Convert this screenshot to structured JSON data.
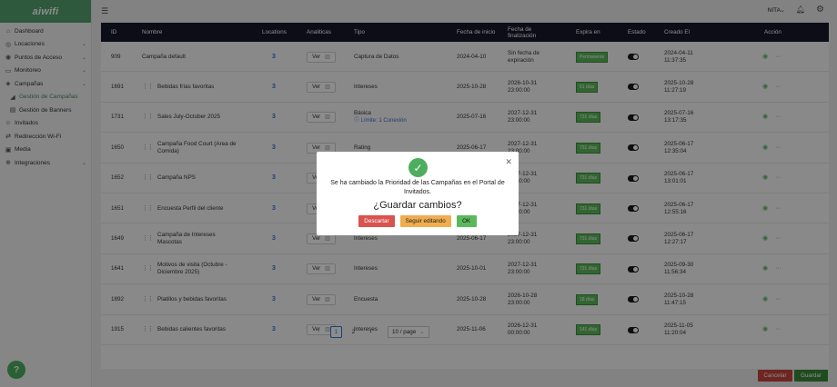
{
  "brand": {
    "logo_text": "aiwifi",
    "color": "#56a26f"
  },
  "sidebar": {
    "items": [
      {
        "label": "Dashboard",
        "icon": "home-icon",
        "chevron": false
      },
      {
        "label": "Locaciones",
        "icon": "location-icon",
        "chevron": true
      },
      {
        "label": "Puntos de Acceso",
        "icon": "wifi-icon",
        "chevron": true
      },
      {
        "label": "Monitoreo",
        "icon": "monitor-icon",
        "chevron": true
      },
      {
        "label": "Campañas",
        "icon": "campaign-icon",
        "chevron": true
      },
      {
        "label": "Gestión de Campañas",
        "icon": "chart-icon",
        "sub": true,
        "active": true
      },
      {
        "label": "Gestión de Banners",
        "icon": "banner-icon",
        "sub": true
      },
      {
        "label": "Invitados",
        "icon": "guests-icon",
        "chevron": false
      },
      {
        "label": "Redirección Wi-Fi",
        "icon": "redirect-icon",
        "chevron": false
      },
      {
        "label": "Media",
        "icon": "media-icon",
        "chevron": false
      },
      {
        "label": "Integraciones",
        "icon": "integrations-icon",
        "chevron": true
      }
    ]
  },
  "topbar": {
    "user_name": "NITA"
  },
  "table": {
    "headers": {
      "id": "ID",
      "nombre": "Nombre",
      "locations": "Locations",
      "analiticas": "Analiticas",
      "tipo": "Tipo",
      "fecha_inicio": "Fecha de inicio",
      "fecha_fin": "Fecha de finalización",
      "expira": "Expira en",
      "estado": "Estado",
      "creado": "Creado El",
      "accion": "Acción"
    },
    "rows": [
      {
        "id": "909",
        "nombre": "Campaña default",
        "drag": false,
        "locations": "3",
        "ver": "Ver",
        "tipo": "Captura de Datos",
        "tipo_extra": "",
        "inicio": "2024-04-10",
        "fin1": "Sin fecha de",
        "fin2": "expiración",
        "expira": "Permanente",
        "creado1": "2024-04-11",
        "creado2": "11:37:35"
      },
      {
        "id": "1691",
        "nombre": "Bebidas frías favoritas",
        "drag": true,
        "locations": "3",
        "ver": "Ver",
        "tipo": "Intereses",
        "tipo_extra": "",
        "inicio": "2025-10-28",
        "fin1": "2026-10-31",
        "fin2": "23:00:00",
        "expira": "61 días",
        "creado1": "2025-10-28",
        "creado2": "11:27:19"
      },
      {
        "id": "1731",
        "nombre": "Sales July-October 2025",
        "drag": true,
        "locations": "3",
        "ver": "Ver",
        "tipo": "Básica",
        "tipo_extra": "Límite: 1 Conexión",
        "inicio": "2025-07-16",
        "fin1": "2027-12-31",
        "fin2": "23:00:00",
        "expira": "731 días",
        "creado1": "2025-07-16",
        "creado2": "13:17:35"
      },
      {
        "id": "1650",
        "nombre": "Campaña Food Court (Area de Comida)",
        "drag": true,
        "locations": "3",
        "ver": "Ver",
        "tipo": "Rating",
        "tipo_extra": "",
        "inicio": "2025-06-17",
        "fin1": "2027-12-31",
        "fin2": "23:00:00",
        "expira": "731 días",
        "creado1": "2025-06-17",
        "creado2": "12:35:04"
      },
      {
        "id": "1652",
        "nombre": "Campaña NPS",
        "drag": true,
        "locations": "3",
        "ver": "Ver",
        "tipo": "",
        "tipo_extra": "",
        "inicio": "",
        "fin1": "2027-12-31",
        "fin2": "23:00:00",
        "expira": "731 días",
        "creado1": "2025-06-17",
        "creado2": "13:01:01"
      },
      {
        "id": "1651",
        "nombre": "Encuesta Perfil del cliente",
        "drag": true,
        "locations": "3",
        "ver": "Ver",
        "tipo": "",
        "tipo_extra": "",
        "inicio": "",
        "fin1": "2027-12-31",
        "fin2": "23:00:00",
        "expira": "731 días",
        "creado1": "2025-06-17",
        "creado2": "12:55:16"
      },
      {
        "id": "1649",
        "nombre": "Campaña de Intereses Mascotas",
        "drag": true,
        "locations": "3",
        "ver": "Ver",
        "tipo": "Intereses",
        "tipo_extra": "",
        "inicio": "2025-06-17",
        "fin1": "2027-12-31",
        "fin2": "23:00:00",
        "expira": "731 días",
        "creado1": "2025-06-17",
        "creado2": "12:27:17"
      },
      {
        "id": "1641",
        "nombre": "Motivos de visita (Octubre - Diciembre 2025)",
        "drag": true,
        "locations": "3",
        "ver": "Ver",
        "tipo": "Intereses",
        "tipo_extra": "",
        "inicio": "2025-10-01",
        "fin1": "2027-12-31",
        "fin2": "23:00:00",
        "expira": "731 días",
        "creado1": "2025-09-30",
        "creado2": "11:56:34"
      },
      {
        "id": "1892",
        "nombre": "Platillos y bebidas favoritas",
        "drag": true,
        "locations": "3",
        "ver": "Ver",
        "tipo": "Encuesta",
        "tipo_extra": "",
        "inicio": "2025-10-28",
        "fin1": "2026-10-28",
        "fin2": "23:00:00",
        "expira": "18 días",
        "creado1": "2025-10-28",
        "creado2": "11:47:15"
      },
      {
        "id": "1915",
        "nombre": "Bebidas calientes favoritas",
        "drag": true,
        "locations": "3",
        "ver": "Ver",
        "tipo": "Intereses",
        "tipo_extra": "",
        "inicio": "2025-11-06",
        "fin1": "2026-12-31",
        "fin2": "00:00:00",
        "expira": "141 días",
        "creado1": "2025-11-05",
        "creado2": "11:20:04"
      }
    ]
  },
  "pagination": {
    "pages": [
      "1",
      "2"
    ],
    "current": "1",
    "per_page": "10 / page"
  },
  "footer": {
    "cancel_label": "Cancelar",
    "save_label": "Guardar"
  },
  "help_label": "?",
  "modal": {
    "message": "Se ha cambiado la Prioridad de las Campañas en el Portal de Invitados.",
    "question": "¿Guardar cambios?",
    "discard_label": "Descartar",
    "keep_editing_label": "Seguir editando",
    "ok_label": "OK"
  }
}
